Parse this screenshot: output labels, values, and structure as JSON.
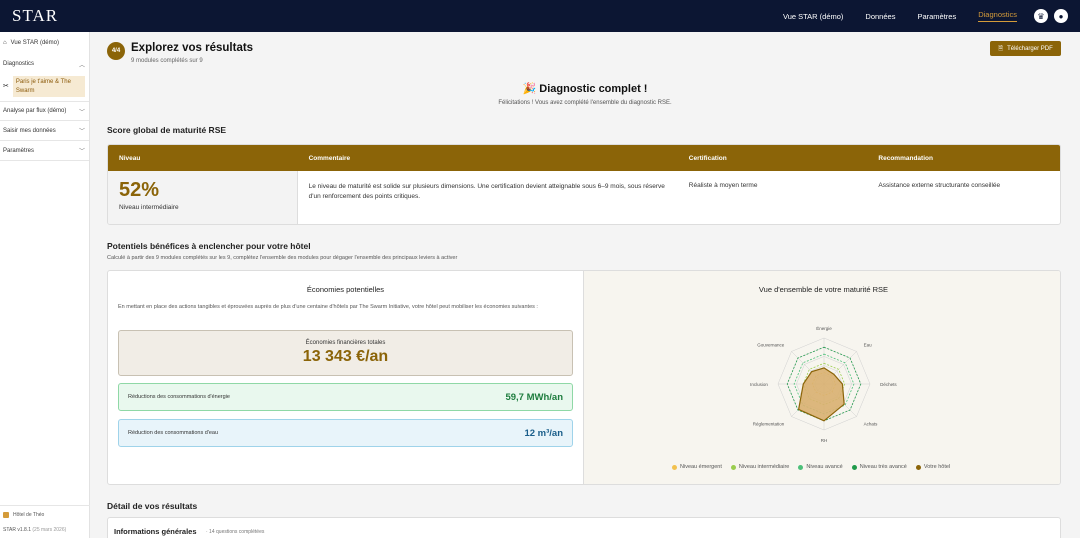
{
  "app": {
    "logo": "STAR"
  },
  "nav": {
    "items": [
      "Vue STAR (démo)",
      "Données",
      "Paramètres",
      "Diagnostics"
    ],
    "active": "Diagnostics"
  },
  "sidebar": {
    "vue_star": "Vue STAR (démo)",
    "diagnostics": "Diagnostics",
    "diag_sub": "Paris je t'aime & The Swarm",
    "analyse": "Analyse par flux (démo)",
    "saisir": "Saisir mes données",
    "parametres": "Paramètres",
    "hotel": "Hôtel de Théo",
    "version": "STAR v1.8.1",
    "version_date": "(25 mars 2026)"
  },
  "header": {
    "step_badge": "4/4",
    "title": "Explorez vos résultats",
    "subtitle": "9 modules complétés sur 9",
    "pdf_button": "Télécharger PDF"
  },
  "completion": {
    "title": "Diagnostic complet !",
    "subtitle": "Félicitations ! Vous avez complété l'ensemble du diagnostic RSE."
  },
  "score": {
    "section_title": "Score global de maturité RSE",
    "headers": [
      "Niveau",
      "Commentaire",
      "Certification",
      "Recommandation"
    ],
    "percent": "52%",
    "level": "Niveau intermédiaire",
    "comment": "Le niveau de maturité est solide sur plusieurs dimensions. Une certification devient atteignable sous 6–9 mois, sous réserve d'un renforcement des points critiques.",
    "certification": "Réaliste à moyen terme",
    "recommendation": "Assistance externe structurante conseillée"
  },
  "benefits": {
    "section_title": "Potentiels bénéfices à enclencher pour votre hôtel",
    "subtitle": "Calculé à partir des 9 modules complétés sur les 9, complétez l'ensemble des modules pour dégager l'ensemble des principaux leviers à activer",
    "eco_title": "Économies potentielles",
    "eco_intro": "En mettant en place des actions tangibles et éprouvées auprès de plus d'une centaine d'hôtels par The Swarm Initiative, votre hôtel peut mobiliser les économies suivantes :",
    "total_label": "Économies financières totales",
    "total_value": "13 343 €/an",
    "energy_label": "Réductions des consommations d'énergie",
    "energy_value": "59,7 MWh/an",
    "water_label": "Réduction des consommations d'eau",
    "water_value": "12 m³/an"
  },
  "radar": {
    "title": "Vue d'ensemble de votre maturité RSE",
    "axes": [
      "Énergie",
      "Eau",
      "Déchets",
      "Achats",
      "RH",
      "Réglementation",
      "Inclusion",
      "Gouvernance"
    ],
    "hotel_values": [
      0.35,
      0.3,
      0.4,
      0.62,
      0.8,
      0.78,
      0.45,
      0.38
    ],
    "levels": [
      {
        "name": "Niveau émergent",
        "color": "#f2c14e"
      },
      {
        "name": "Niveau intermédiaire",
        "color": "#9acd4e"
      },
      {
        "name": "Niveau avancé",
        "color": "#4cc079"
      },
      {
        "name": "Niveau très avancé",
        "color": "#1f9a4a"
      },
      {
        "name": "Votre hôtel",
        "color": "#8b6408"
      }
    ],
    "colors": {
      "hotel_fill": "#d8b070",
      "hotel_stroke": "#8b6408",
      "grid": "#cfcfcf"
    }
  },
  "detail": {
    "section_title": "Détail de vos résultats",
    "card_title": "Informations générales",
    "card_count": "· 14 questions complétées"
  }
}
